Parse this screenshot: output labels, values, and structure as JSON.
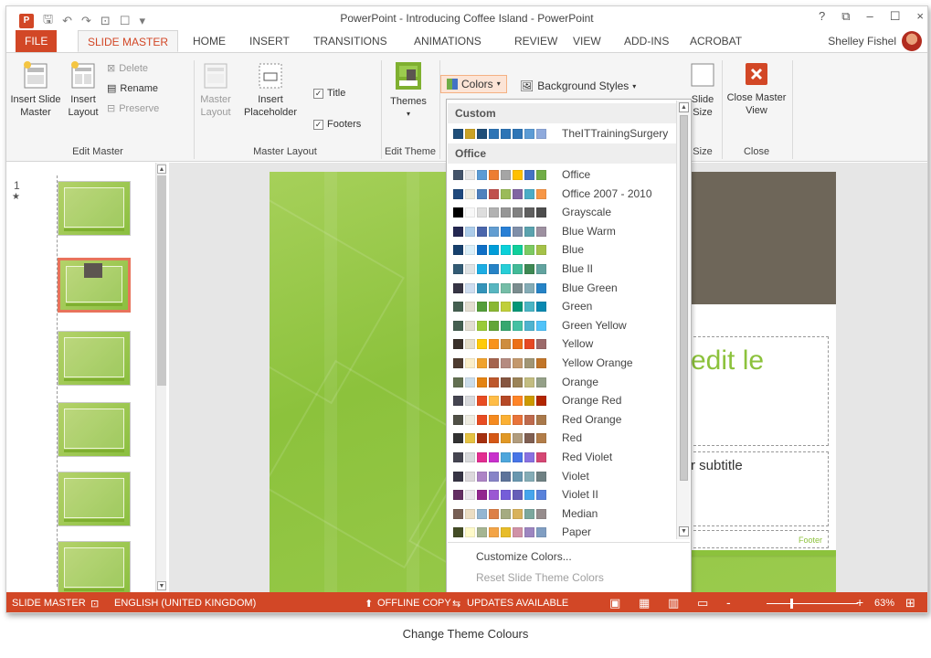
{
  "window": {
    "title": "PowerPoint - Introducing Coffee Island - PowerPoint",
    "controls": [
      "?",
      "⧉",
      "–",
      "☐",
      "×"
    ]
  },
  "tabs": [
    {
      "label": "FILE"
    },
    {
      "label": "SLIDE MASTER"
    },
    {
      "label": "HOME"
    },
    {
      "label": "INSERT"
    },
    {
      "label": "TRANSITIONS"
    },
    {
      "label": "ANIMATIONS"
    },
    {
      "label": "REVIEW"
    },
    {
      "label": "VIEW"
    },
    {
      "label": "ADD-INS"
    },
    {
      "label": "ACROBAT"
    }
  ],
  "user": {
    "name": "Shelley Fishel"
  },
  "ribbon": {
    "edit_master": {
      "insert_slide_master": "Insert Slide Master",
      "insert_layout": "Insert Layout",
      "delete": "Delete",
      "rename": "Rename",
      "preserve": "Preserve",
      "group_label": "Edit Master"
    },
    "master_layout": {
      "master_layout": "Master Layout",
      "insert_placeholder": "Insert Placeholder",
      "title": "Title",
      "footers": "Footers",
      "group_label": "Master Layout"
    },
    "edit_theme": {
      "themes": "Themes",
      "group_label": "Edit Theme"
    },
    "background": {
      "colors": "Colors",
      "background_styles": "Background Styles"
    },
    "size": {
      "slide_size": "Slide Size",
      "group_label": "Size"
    },
    "close": {
      "close_master_view": "Close Master View",
      "group_label": "Close"
    }
  },
  "thumbnails": {
    "numbers": [
      "1",
      "★"
    ]
  },
  "slide": {
    "title_text": "edit le",
    "subtitle_text": "r subtitle",
    "footer_text": "Footer"
  },
  "colors_menu": {
    "custom_header": "Custom",
    "office_header": "Office",
    "custom_schemes": [
      {
        "name": "TheITTrainingSurgery",
        "swatches": [
          "#1f4e79",
          "#c9a227",
          "#1f4e79",
          "#2e75b6",
          "#2e75b6",
          "#2e75b6",
          "#5b9bd5",
          "#8faadc"
        ]
      }
    ],
    "schemes": [
      {
        "name": "Office",
        "swatches": [
          "#44546a",
          "#e7e6e6",
          "#5b9bd5",
          "#ed7d31",
          "#a5a5a5",
          "#ffc000",
          "#4472c4",
          "#70ad47"
        ]
      },
      {
        "name": "Office 2007 - 2010",
        "swatches": [
          "#1f497d",
          "#eeece1",
          "#4f81bd",
          "#c0504d",
          "#9bbb59",
          "#8064a2",
          "#4bacc6",
          "#f79646"
        ]
      },
      {
        "name": "Grayscale",
        "swatches": [
          "#000000",
          "#f8f8f8",
          "#dddddd",
          "#b2b2b2",
          "#969696",
          "#808080",
          "#5f5f5f",
          "#4d4d4d"
        ]
      },
      {
        "name": "Blue Warm",
        "swatches": [
          "#242852",
          "#acccea",
          "#4a66ac",
          "#629dd1",
          "#297fd5",
          "#7f8fa9",
          "#5aa2ae",
          "#9d90a0"
        ]
      },
      {
        "name": "Blue",
        "swatches": [
          "#17406d",
          "#dbeff9",
          "#0f6fc6",
          "#009dd9",
          "#0bd0d9",
          "#10cf9b",
          "#7cca62",
          "#a5c249"
        ]
      },
      {
        "name": "Blue II",
        "swatches": [
          "#335b74",
          "#dfe3e5",
          "#1cade4",
          "#2683c6",
          "#27ced7",
          "#42ba97",
          "#3e8853",
          "#62a39f"
        ]
      },
      {
        "name": "Blue Green",
        "swatches": [
          "#373545",
          "#ceddf0",
          "#3494ba",
          "#58b6c0",
          "#75bda7",
          "#7a8c8e",
          "#84acb6",
          "#2683c6"
        ]
      },
      {
        "name": "Green",
        "swatches": [
          "#455f51",
          "#e3ded1",
          "#549e39",
          "#8ab833",
          "#c0cf3a",
          "#029676",
          "#4ab5c4",
          "#0989b1"
        ]
      },
      {
        "name": "Green Yellow",
        "swatches": [
          "#455f51",
          "#e3ded1",
          "#99cb38",
          "#63a537",
          "#37a76f",
          "#44c1a3",
          "#4eb3cf",
          "#51c3f9"
        ]
      },
      {
        "name": "Yellow",
        "swatches": [
          "#39302a",
          "#e5dec9",
          "#ffca08",
          "#f8931d",
          "#ce8d3e",
          "#ec7016",
          "#e64823",
          "#9c6a6a"
        ]
      },
      {
        "name": "Yellow Orange",
        "swatches": [
          "#4e3b30",
          "#fbeec9",
          "#f0a22e",
          "#a5644e",
          "#b58b80",
          "#c3986d",
          "#a19574",
          "#c17529"
        ]
      },
      {
        "name": "Orange",
        "swatches": [
          "#637052",
          "#ccddea",
          "#e48312",
          "#bd582c",
          "#865640",
          "#9b8357",
          "#c2bc80",
          "#94a088"
        ]
      },
      {
        "name": "Orange Red",
        "swatches": [
          "#454551",
          "#d8d9dc",
          "#e84c22",
          "#ffbd47",
          "#b64926",
          "#ff8427",
          "#cc9900",
          "#b22600"
        ]
      },
      {
        "name": "Red Orange",
        "swatches": [
          "#505046",
          "#eeece1",
          "#e84c22",
          "#f58a1f",
          "#fbb034",
          "#e8733a",
          "#be6a4d",
          "#a9794b"
        ]
      },
      {
        "name": "Red",
        "swatches": [
          "#323232",
          "#e5c243",
          "#a5300f",
          "#d55816",
          "#e19825",
          "#b19c7d",
          "#7f5f52",
          "#b27d49"
        ]
      },
      {
        "name": "Red Violet",
        "swatches": [
          "#454551",
          "#d8d9dc",
          "#e32d91",
          "#c830cc",
          "#4ea6dc",
          "#4775e7",
          "#8971e1",
          "#d54773"
        ]
      },
      {
        "name": "Violet",
        "swatches": [
          "#373545",
          "#dcd8dc",
          "#ad84c6",
          "#8784c7",
          "#5d739a",
          "#6997af",
          "#84acb6",
          "#6f8183"
        ]
      },
      {
        "name": "Violet II",
        "swatches": [
          "#632e62",
          "#eae5eb",
          "#92278f",
          "#9b57d3",
          "#755dd9",
          "#665eb8",
          "#45a5ed",
          "#5982db"
        ]
      },
      {
        "name": "Median",
        "swatches": [
          "#775f55",
          "#ebddc3",
          "#94b6d2",
          "#dd8047",
          "#a5ab81",
          "#d8b25c",
          "#7ba79d",
          "#968c8c"
        ]
      },
      {
        "name": "Paper",
        "swatches": [
          "#444d26",
          "#fefac9",
          "#a5b592",
          "#f3a447",
          "#e7bc29",
          "#d092a7",
          "#9c85c0",
          "#809ec2"
        ]
      }
    ],
    "customize": "Customize Colors...",
    "reset": "Reset Slide Theme Colors"
  },
  "statusbar": {
    "mode": "SLIDE MASTER",
    "language": "ENGLISH (UNITED KINGDOM)",
    "offline": "OFFLINE COPY",
    "updates": "UPDATES AVAILABLE",
    "zoom_minus": "-",
    "zoom_plus": "+",
    "zoom": "63%"
  },
  "caption": "Change Theme Colours"
}
